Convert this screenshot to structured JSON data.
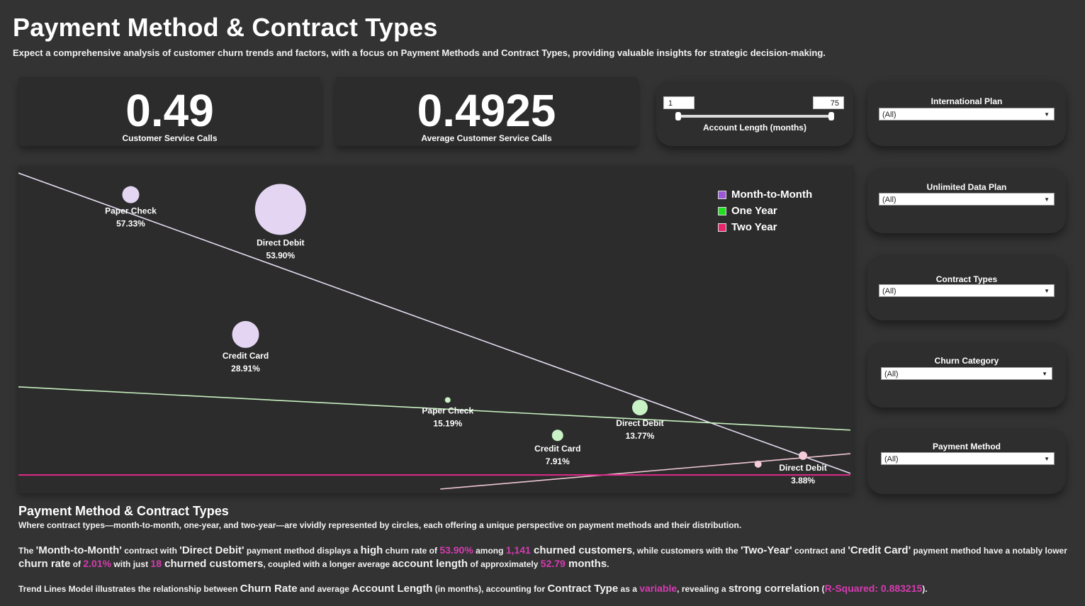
{
  "header": {
    "title": "Payment Method & Contract Types",
    "subtitle": "Expect a comprehensive analysis of customer churn trends and factors, with a focus on Payment Methods and Contract Types, providing valuable insights for strategic decision-making."
  },
  "kpis": [
    {
      "value": "0.49",
      "label": "Customer Service Calls"
    },
    {
      "value": "0.4925",
      "label": "Average Customer Service Calls"
    }
  ],
  "slider": {
    "min_value": "1",
    "max_value": "75",
    "label": "Account Length (months)"
  },
  "filters": [
    {
      "label": "International Plan",
      "value": "(All)"
    },
    {
      "label": "Unlimited Data Plan",
      "value": "(All)"
    },
    {
      "label": "Contract Types",
      "value": "(All)"
    },
    {
      "label": "Churn Category",
      "value": "(All)"
    },
    {
      "label": "Payment Method",
      "value": "(All)"
    }
  ],
  "colors": {
    "month_to_month": "#e4d6f3",
    "one_year": "#c9f2c5",
    "two_year": "#f4cbd7",
    "trend_mtm": "#e6ddf2",
    "trend_one_year": "#c7f0bf",
    "trend_two_year": "#f0c7d4",
    "trend_two_year_flat": "#e0288b",
    "legend_mtm": "#9b59d9",
    "legend_one_year": "#22dd22",
    "legend_two_year": "#e8246a",
    "highlight": "#d63bb1"
  },
  "chart_data": {
    "type": "scatter",
    "x_range": [
      0,
      100
    ],
    "y_range": [
      0,
      100
    ],
    "series": [
      {
        "name": "Month-to-Month",
        "points": [
          {
            "label": "Paper Check",
            "value": "57.33%",
            "x": 13.5,
            "y": 91.2,
            "size": 12
          },
          {
            "label": "Direct Debit",
            "value": "53.90%",
            "x": 31.5,
            "y": 86.7,
            "size": 36
          },
          {
            "label": "Credit Card",
            "value": "28.91%",
            "x": 27.3,
            "y": 48.5,
            "size": 19
          }
        ]
      },
      {
        "name": "One Year",
        "points": [
          {
            "label": "Paper Check",
            "value": "15.19%",
            "x": 51.6,
            "y": 28.5,
            "size": 4
          },
          {
            "label": "Direct Debit",
            "value": "13.77%",
            "x": 74.7,
            "y": 26.2,
            "size": 11
          },
          {
            "label": "Credit Card",
            "value": "7.91%",
            "x": 64.8,
            "y": 17.7,
            "size": 8
          }
        ]
      },
      {
        "name": "Two Year",
        "points": [
          {
            "label": "Direct Debit",
            "value": "3.88%",
            "x": 94.3,
            "y": 11.5,
            "size": 6
          },
          {
            "label": "",
            "value": "",
            "x": 88.9,
            "y": 8.9,
            "size": 5
          }
        ]
      }
    ],
    "trend_lines": [
      {
        "series": "Month-to-Month",
        "x1": 0,
        "y1": 97.8,
        "x2": 100,
        "y2": 6.1
      },
      {
        "series": "One Year",
        "x1": 0,
        "y1": 32.5,
        "x2": 100,
        "y2": 19.3
      },
      {
        "series": "Two Year",
        "x1": 50.7,
        "y1": 1.3,
        "x2": 100,
        "y2": 12.1
      },
      {
        "series": "Two Year",
        "x1": 0,
        "y1": 5.6,
        "x2": 100,
        "y2": 5.6
      }
    ],
    "legend": [
      "Month-to-Month",
      "One Year",
      "Two Year"
    ],
    "legend_position": "top-right"
  },
  "description": {
    "title": "Payment Method & Contract Types",
    "line1": "Where contract types—month-to-month, one-year, and two-year—are vividly represented by circles, each offering a unique perspective on payment methods and their distribution.",
    "p2": {
      "t1": "The ",
      "t2": "'Month-to-Month'",
      "t3": " contract with ",
      "t4": "'Direct Debit'",
      "t5": " payment method displays a ",
      "t6": "high",
      "t7": " churn rate of ",
      "t8": "53.90%",
      "t9": " among ",
      "t10": "1,141",
      "t11": " churned customers",
      "t12": ", while customers with the ",
      "t13": "'Two-Year'",
      "t14": " contract and ",
      "t15": "'Credit Card'",
      "t16": " payment method have a notably lower ",
      "t17": "churn rate",
      "t18": " of ",
      "t19": "2.01%",
      "t20": " with just ",
      "t21": "18",
      "t22": " churned customers",
      "t23": ", coupled with a longer average ",
      "t24": "account length",
      "t25": " of approximately ",
      "t26": "52.79",
      "t27": " months",
      "t28": "."
    },
    "p3": {
      "t1": "Trend Lines Model illustrates the relationship between ",
      "t2": "Churn Rate",
      "t3": " and average ",
      "t4": "Account Length",
      "t5": " (in months), accounting for ",
      "t6": "Contract Type",
      "t7": " as a ",
      "t8": "variable",
      "t9": ", revealing a ",
      "t10": "strong correlation",
      "t11": " (",
      "t12": "R-Squared: 0.883215",
      "t13": ")."
    }
  }
}
